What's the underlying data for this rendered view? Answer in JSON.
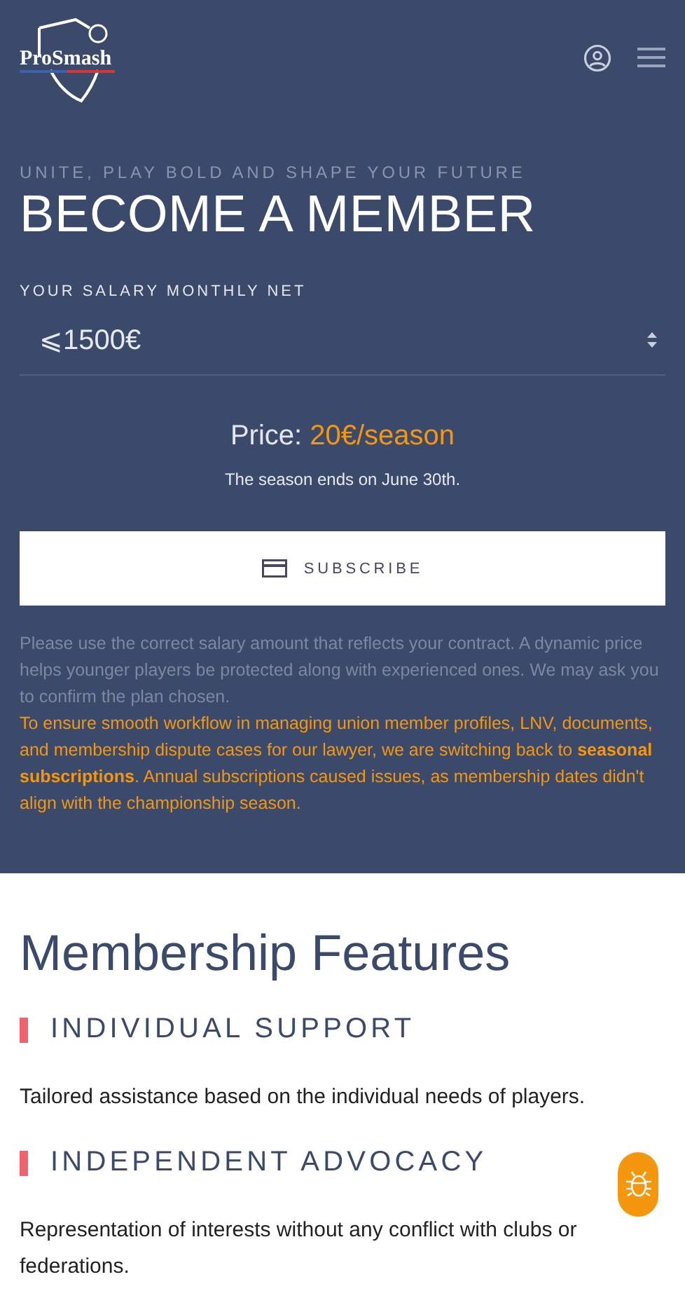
{
  "header": {
    "logo": "ProSmash"
  },
  "hero": {
    "tagline": "UNITE, PLAY BOLD AND SHAPE YOUR FUTURE",
    "title": "BECOME A MEMBER",
    "salary_label": "YOUR SALARY MONTHLY NET",
    "salary_value": "⩽1500€",
    "price_label": "Price:",
    "price_value": "20€/season",
    "season_note": "The season ends on June 30th.",
    "subscribe": "SUBSCRIBE",
    "notes": [
      {
        "kind": "muted",
        "text": "Please use the correct salary amount that reflects your contract. A dynamic price helps younger players be protected along with experienced ones. We may ask you to confirm the plan chosen."
      },
      {
        "kind": "warning",
        "text": "To ensure smooth workflow in managing union member profiles, LNV, documents, and membership dispute cases for our lawyer, we are switching back to **seasonal subscriptions**. Annual subscriptions caused issues, as membership dates didn't align with the championship season."
      }
    ]
  },
  "features": {
    "title": "Membership Features",
    "items": [
      {
        "heading": "INDIVIDUAL SUPPORT",
        "text": "Tailored assistance based on the individual needs of players."
      },
      {
        "heading": "INDEPENDENT ADVOCACY",
        "text": "Representation of interests without any conflict with clubs or federations."
      }
    ]
  }
}
